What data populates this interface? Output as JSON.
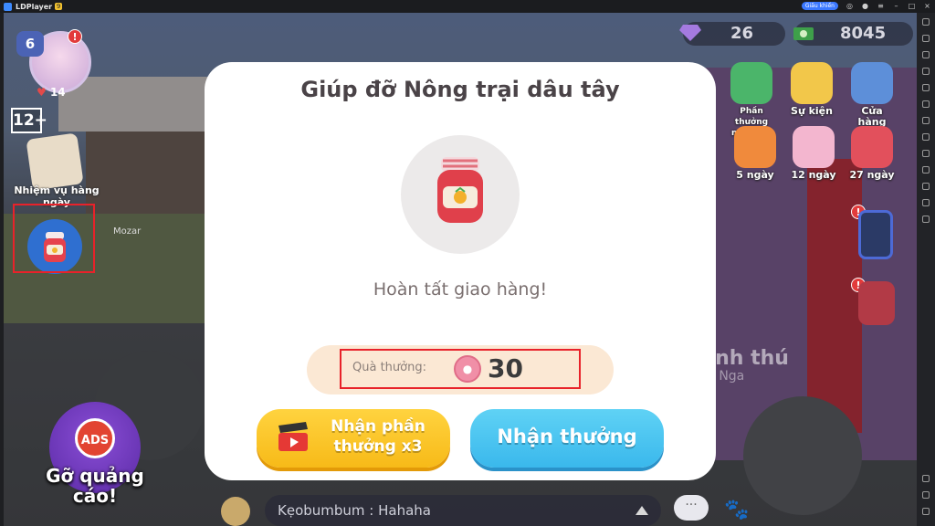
{
  "window": {
    "app_name": "LDPlayer",
    "app_badge": "9",
    "pill_label": "Giấu khiển"
  },
  "hud": {
    "level": "6",
    "hearts": "14",
    "age_rating": "12+",
    "quest_label": "Nhiệm vụ hàng ngày",
    "npc_name": "Mozar",
    "gems": "26",
    "cash": "8045",
    "menu": [
      {
        "label": "Phần thưởng miễn phí"
      },
      {
        "label": "Sự kiện"
      },
      {
        "label": "Cửa hàng"
      },
      {
        "label": "5 ngày"
      },
      {
        "label": "12 ngày"
      },
      {
        "label": "27 ngày"
      }
    ],
    "ads_label": "ADS",
    "remove_ads_label": "Gỡ quảng cáo!",
    "chat_message": "Kẹobumbum : Hahaha",
    "bg_text_1": "linh thú",
    "bg_text_2": "n Nga",
    "bubble": "···"
  },
  "modal": {
    "title": "Giúp đỡ Nông trại dâu tây",
    "status": "Hoàn tất giao hàng!",
    "reward_label": "Quà thưởng:",
    "reward_value": "30",
    "btn_ad": "Nhận phần thưởng x3",
    "btn_claim": "Nhận thưởng"
  },
  "colors": {
    "accent_yellow": "#f7ba18",
    "accent_blue": "#3ab8ec",
    "highlight_red": "#e8222a"
  }
}
